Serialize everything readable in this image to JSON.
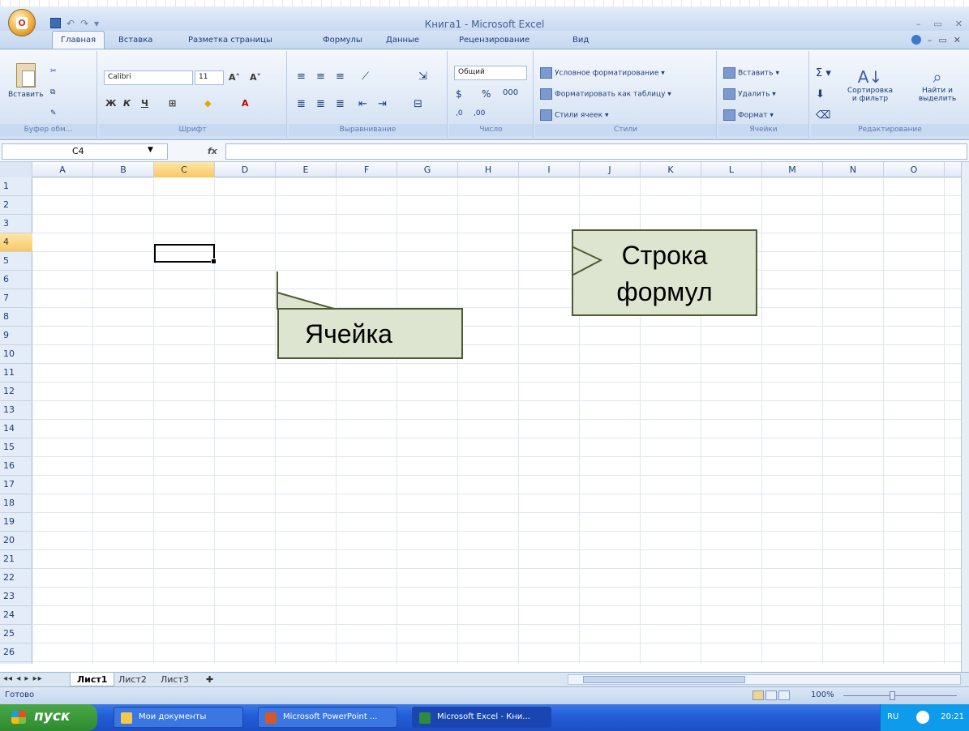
{
  "window": {
    "title": "Книга1 - Microsoft Excel",
    "office_button": "Office"
  },
  "tabs": [
    "Главная",
    "Вставка",
    "Разметка страницы",
    "Формулы",
    "Данные",
    "Рецензирование",
    "Вид"
  ],
  "ribbon": {
    "clipboard": {
      "paste": "Вставить",
      "label": "Буфер обм..."
    },
    "font": {
      "name": "Calibri",
      "size": "11",
      "label": "Шрифт"
    },
    "alignment": {
      "label": "Выравнивание"
    },
    "number": {
      "format": "Общий",
      "label": "Число"
    },
    "styles": {
      "conditional": "Условное форматирование",
      "as_table": "Форматировать как таблицу",
      "cell_styles": "Стили ячеек",
      "label": "Стили"
    },
    "cells": {
      "insert": "Вставить",
      "delete": "Удалить",
      "format": "Формат",
      "label": "Ячейки"
    },
    "editing": {
      "sort": "Сортировка",
      "sort2": "и фильтр",
      "find": "Найти и",
      "find2": "выделить",
      "label": "Редактирование"
    }
  },
  "formula_bar": {
    "name_box": "C4",
    "fx": "fx",
    "value": ""
  },
  "columns": [
    "A",
    "B",
    "C",
    "D",
    "E",
    "F",
    "G",
    "H",
    "I",
    "J",
    "K",
    "L",
    "M",
    "N",
    "O"
  ],
  "rows": [
    "1",
    "2",
    "3",
    "4",
    "5",
    "6",
    "7",
    "8",
    "9",
    "10",
    "11",
    "12",
    "13",
    "14",
    "15",
    "16",
    "17",
    "18",
    "19",
    "20",
    "21",
    "22",
    "23",
    "24",
    "25",
    "26"
  ],
  "selected": {
    "column": "C",
    "row": "4"
  },
  "sheets": [
    "Лист1",
    "Лист2",
    "Лист3"
  ],
  "status": {
    "ready": "Готово",
    "zoom": "100%"
  },
  "taskbar": {
    "start": "пуск",
    "items": [
      "Мои документы",
      "Microsoft PowerPoint ...",
      "Microsoft Excel - Кни..."
    ],
    "lang": "RU",
    "clock": "20:21"
  },
  "callouts": {
    "cell": "Ячейка",
    "formula_bar": "Строка формул"
  }
}
